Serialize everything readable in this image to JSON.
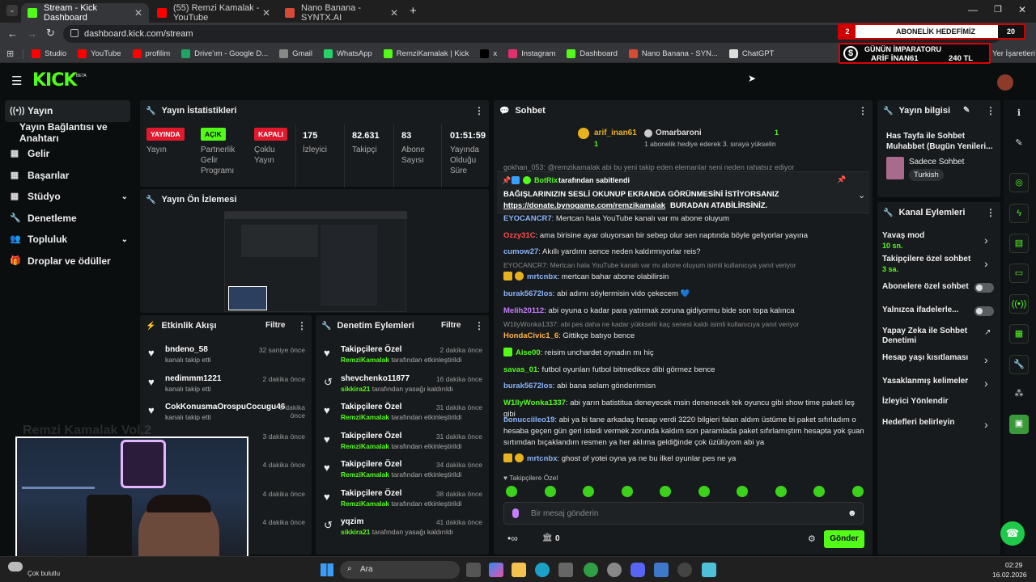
{
  "browser": {
    "tabs": [
      {
        "title": "Stream - Kick Dashboard",
        "color": "#53fc18"
      },
      {
        "title": "(55) Remzi Kamalak - YouTube",
        "color": "#ff0000"
      },
      {
        "title": "Nano Banana - SYNTX.AI",
        "color": "#d64a36"
      }
    ],
    "url": "dashboard.kick.com/stream",
    "bookmarks": [
      {
        "label": "Studio",
        "color": "#ff0000"
      },
      {
        "label": "YouTube",
        "color": "#ff0000"
      },
      {
        "label": "profilim",
        "color": "#ff0000"
      },
      {
        "label": "Drive'ım - Google D...",
        "color": "#1fa463"
      },
      {
        "label": "Gmail",
        "color": "#888888"
      },
      {
        "label": "WhatsApp",
        "color": "#25d366"
      },
      {
        "label": "RemziKamalak | Kick",
        "color": "#53fc18"
      },
      {
        "label": "x",
        "color": "#000000"
      },
      {
        "label": "Instagram",
        "color": "#e1306c"
      },
      {
        "label": "Dashboard",
        "color": "#53fc18"
      },
      {
        "label": "Nano Banana - SYN...",
        "color": "#d64a36"
      },
      {
        "label": "ChatGPT",
        "color": "#dddddd"
      }
    ],
    "bookmarks_other": "Yer İşaretleri"
  },
  "overlay": {
    "goal_count": "2",
    "goal_label": "ABONELİK HEDEFİMİZ",
    "goal_target": "20",
    "emperor_title": "GÜNÜN İMPARATORU",
    "emperor_name": "ARİF İNAN61",
    "emperor_amount": "240 TL",
    "webcam_caption": "Remzi Kamalak Vol.2"
  },
  "kick": {
    "logo": "KICK",
    "logo_beta": "BETA"
  },
  "nav": {
    "items": [
      {
        "label": "Yayın",
        "icon": "broadcast-icon"
      },
      {
        "label": "Yayın Bağlantısı ve Anahtarı",
        "icon": ""
      },
      {
        "label": "Gelir",
        "icon": "revenue-icon"
      },
      {
        "label": "Başarılar",
        "icon": "achievements-icon"
      },
      {
        "label": "Stüdyo",
        "icon": "studio-icon"
      },
      {
        "label": "Denetleme",
        "icon": "moderation-icon"
      },
      {
        "label": "Topluluk",
        "icon": "community-icon"
      },
      {
        "label": "Droplar ve ödüller",
        "icon": "drops-icon"
      }
    ]
  },
  "stats": {
    "title": "Yayın İstatistikleri",
    "live_badge": "YAYINDA",
    "live_label": "Yayın",
    "partner_badge": "AÇIK",
    "partner_label": "Partnerlik Gelir Programı",
    "multi_badge": "KAPALI",
    "multi_label": "Çoklu Yayın",
    "viewers": "175",
    "viewers_label": "İzleyici",
    "followers": "82.631",
    "followers_label": "Takipçi",
    "subs": "83",
    "subs_label": "Abone Sayısı",
    "uptime": "01:51:59",
    "uptime_label": "Yayında Olduğu Süre"
  },
  "preview": {
    "title": "Yayın Ön İzlemesi"
  },
  "activity": {
    "title": "Etkinlik Akışı",
    "filter": "Filtre",
    "events": [
      {
        "user": "bndeno_58",
        "action": "kanalı takip etti",
        "time": "32 saniye önce"
      },
      {
        "user": "nedimmm1221",
        "action": "kanalı takip etti",
        "time": "2 dakika önce"
      },
      {
        "user": "CokKonusmaOrospuCocugu46",
        "action": "kanalı takip etti",
        "time": "3 dakika önce"
      },
      {
        "user": "",
        "action": "",
        "time": "3 dakika önce"
      },
      {
        "user": "",
        "action": "",
        "time": "4 dakika önce"
      },
      {
        "user": "",
        "action": "",
        "time": "4 dakika önce"
      },
      {
        "user": "",
        "action": "",
        "time": "4 dakika önce"
      }
    ]
  },
  "moderation": {
    "title": "Denetim Eylemleri",
    "filter": "Filtre",
    "events": [
      {
        "title": "Takipçilere Özel",
        "by": "RemziKamalak",
        "rest": " tarafından etkinleştirildi",
        "time": "2 dakika önce",
        "icon": "heart-icon"
      },
      {
        "title": "shevchenko11877",
        "by": "sikkira21",
        "rest": " tarafından yasağı kaldırıldı",
        "time": "16 dakika önce",
        "icon": "undo-icon"
      },
      {
        "title": "Takipçilere Özel",
        "by": "RemziKamalak",
        "rest": " tarafından etkinleştirildi",
        "time": "31 dakika önce",
        "icon": "heart-icon"
      },
      {
        "title": "Takipçilere Özel",
        "by": "RemziKamalak",
        "rest": " tarafından etkinleştirildi",
        "time": "31 dakika önce",
        "icon": "heart-icon"
      },
      {
        "title": "Takipçilere Özel",
        "by": "RemziKamalak",
        "rest": " tarafından etkinleştirildi",
        "time": "34 dakika önce",
        "icon": "heart-icon"
      },
      {
        "title": "Takipçilere Özel",
        "by": "RemziKamalak",
        "rest": " tarafından etkinleştirildi",
        "time": "38 dakika önce",
        "icon": "heart-icon"
      },
      {
        "title": "yqzim",
        "by": "sikkira21",
        "rest": " tarafından yasağı kaldırıldı",
        "time": "41 dakika önce",
        "icon": "undo-icon"
      }
    ]
  },
  "chat": {
    "title": "Sohbet",
    "top_gifter": "arif_inan61",
    "top_gifter_count": "1",
    "second": "Omarbaroni",
    "second_count": "1",
    "gift_note": "1 abonelik hediye ederek 3. sıraya yükselin",
    "partial_line": "gokhan_053: @remzikamalak abi bu yeni takip eden elemanlar seni neden rahatsız ediyor",
    "pinned_by": "BotRix",
    "pinned_suffix": "tarafından sabitlendi",
    "pinned_text": "BAĞIŞLARINIZIN SESLİ OKUNUP EKRANDA GÖRÜNMESİNİ İSTİYORSANIZ",
    "pinned_link": "https://donate.bynogame.com/remzikamalak",
    "pinned_link_tail": " BURADAN ATABİLİRSİNİZ.",
    "messages": [
      {
        "user": "EYOCANCR7",
        "color": "#8ab4f8",
        "text": ": Mertcan hala YouTube kanalı var mı abone oluyum"
      },
      {
        "user": "Ozzy31C",
        "color": "#ff4d4d",
        "text": ": ama birisine ayar oluyorsan bir sebep olur sen naptında böyle geliyorlar yayına"
      },
      {
        "user": "cumow27",
        "color": "#8ab4f8",
        "text": ": Akıllı yardımı sence neden kaldırmıyorlar reis?"
      },
      {
        "user": "mrtcnbx",
        "color": "#8ab4f8",
        "text": ": mertcan bahar abone olabilirsin",
        "reply": "EYOCANCR7: Mertcan hala YouTube kanalı var mı abone oluyum isimli kullanıcıya yanıt veriyor"
      },
      {
        "user": "burak5672los",
        "color": "#8ab4f8",
        "text": ": abi adımı söylermisin vido çekecem 💙"
      },
      {
        "user": "Melih20112",
        "color": "#c77dff",
        "text": ": abi oyuna o kadar para yatırmak zoruna gidiyormu bide son topa kalınca"
      },
      {
        "user": "HondaCivic1_6",
        "color": "#ffb347",
        "text": ": Gittikçe batıyo bence",
        "reply": "W1llyWonka1337: abi pes daha ne kadar yükkselir kaç senesi kaldı isimli kullanıcıya yanıt veriyor"
      },
      {
        "user": "Aise00",
        "color": "#53fc18",
        "text": ": reisim unchardet oynadın mı hiç"
      },
      {
        "user": "savas_01",
        "color": "#53fc18",
        "text": ": futbol oyunları futbol bitmedikce dibi görmez bence"
      },
      {
        "user": "burak5672los",
        "color": "#8ab4f8",
        "text": ": abi bana selam gönderirmisn"
      },
      {
        "user": "W1llyWonka1337",
        "color": "#53fc18",
        "text": ": abi yarın batistitua deneyecek msin denenecek tek oyuncu gibi show time paketi leş gibi"
      },
      {
        "user": "bonucciileo19",
        "color": "#8ab4f8",
        "text": ": abi ya bi tane arkadaş hesap verdi 3220 bilgieri falan aldım üstüme bi paket sıfırladım o hesaba geçen gün geri istedi vermek zorunda kaldım son paramlada paket sıfırlamıştım hesapta yok şuan sırtımdan bıçaklandım resmen ya her aklıma geldiğinde çok üzülüyom abi ya"
      },
      {
        "user": "mrtcnbx",
        "color": "#8ab4f8",
        "text": ": ghost of yotei oyna ya ne bu ilkel oyunlar pes ne ya"
      }
    ],
    "mode": "Takipçilere Özel",
    "input_placeholder": "Bir mesaj gönderin",
    "send": "Gönder",
    "points": "0"
  },
  "stream_info": {
    "title": "Yayın bilgisi",
    "stream_title": "Has Tayfa ile Sohbet Muhabbet (Bugün Yenileri...",
    "category": "Sadece Sohbet",
    "tag": "Turkish"
  },
  "channel_actions": {
    "title": "Kanal Eylemleri",
    "items": [
      {
        "label": "Yavaş mod",
        "sub": "10 sn.",
        "type": "chevron"
      },
      {
        "label": "Takipçilere özel sohbet",
        "sub": "3 sa.",
        "type": "chevron"
      },
      {
        "label": "Abonelere özel sohbet",
        "sub": "",
        "type": "toggle"
      },
      {
        "label": "Yalnızca ifadelerle...",
        "sub": "",
        "type": "toggle"
      },
      {
        "label": "Yapay Zeka ile Sohbet Denetimi",
        "sub": "",
        "type": "link"
      },
      {
        "label": "Hesap yaşı kısıtlaması",
        "sub": "",
        "type": "chevron"
      },
      {
        "label": "Yasaklanmış kelimeler",
        "sub": "",
        "type": "chevron"
      },
      {
        "label": "İzleyici Yönlendir",
        "sub": "",
        "type": "none"
      },
      {
        "label": "Hedefleri belirleyin",
        "sub": "",
        "type": "chevron"
      }
    ]
  },
  "taskbar": {
    "weather": "Çok bulutlu",
    "search": "Ara",
    "time": "02:29",
    "date": "16.02.2026"
  }
}
